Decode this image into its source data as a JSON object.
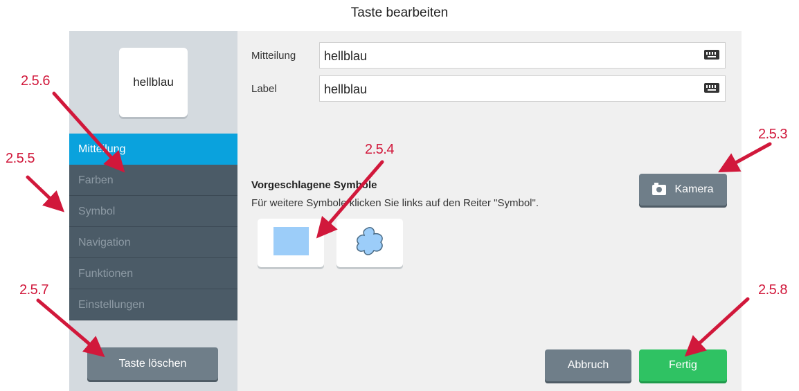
{
  "dialog": {
    "title": "Taste bearbeiten"
  },
  "preview": {
    "text": "hellblau"
  },
  "sidebar": {
    "items": [
      {
        "label": "Mitteilung",
        "active": true
      },
      {
        "label": "Farben",
        "active": false
      },
      {
        "label": "Symbol",
        "active": false
      },
      {
        "label": "Navigation",
        "active": false
      },
      {
        "label": "Funktionen",
        "active": false
      },
      {
        "label": "Einstellungen",
        "active": false
      }
    ],
    "delete_label": "Taste löschen"
  },
  "fields": {
    "message": {
      "label": "Mitteilung",
      "value": "hellblau",
      "icon": "keyboard-icon"
    },
    "label": {
      "label": "Label",
      "value": "hellblau",
      "icon": "keyboard-icon"
    }
  },
  "suggestions": {
    "title": "Vorgeschlagene Symbole",
    "subtitle": "Für weitere Symbole klicken Sie links auf den Reiter \"Symbol\".",
    "symbols": [
      "light-blue-square",
      "light-blue-blob"
    ]
  },
  "buttons": {
    "camera_label": "Kamera",
    "cancel_label": "Abbruch",
    "done_label": "Fertig"
  },
  "annotations": [
    "2.5.6",
    "2.5.5",
    "2.5.4",
    "2.5.3",
    "2.5.7",
    "2.5.8"
  ],
  "colors": {
    "accent": "#0aa2dd",
    "done": "#2fc263",
    "annotation": "#d1183b",
    "symbol_fill": "#9ccdf9"
  }
}
